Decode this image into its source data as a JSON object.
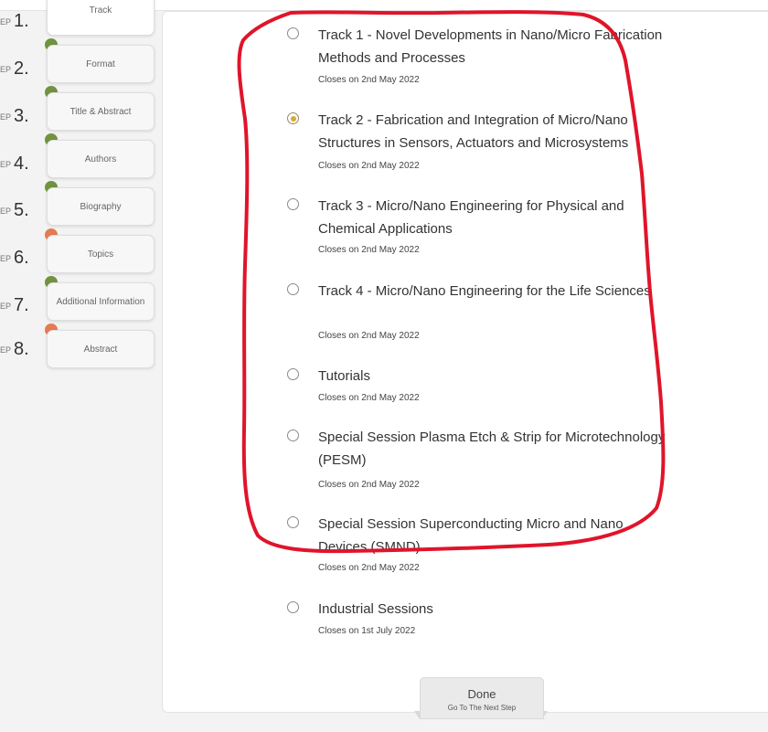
{
  "steps": [
    {
      "num": "1.",
      "label": "Track",
      "status": "active",
      "status_color": "none"
    },
    {
      "num": "2.",
      "label": "Format",
      "status": "complete",
      "status_color": "#72923f"
    },
    {
      "num": "3.",
      "label": "Title & Abstract",
      "status": "complete",
      "status_color": "#72923f"
    },
    {
      "num": "4.",
      "label": "Authors",
      "status": "complete",
      "status_color": "#72923f"
    },
    {
      "num": "5.",
      "label": "Biography",
      "status": "complete",
      "status_color": "#72923f"
    },
    {
      "num": "6.",
      "label": "Topics",
      "status": "incomplete",
      "status_color": "#e47b51"
    },
    {
      "num": "7.",
      "label": "Additional Information",
      "status": "complete",
      "status_color": "#72923f"
    },
    {
      "num": "8.",
      "label": "Abstract",
      "status": "incomplete",
      "status_color": "#e47b51"
    }
  ],
  "step_prefix": "EP",
  "tracks": [
    {
      "title": "Track 1 - Novel Developments in Nano/Micro Fabrication Methods and Processes",
      "closes": "Closes on 2nd May 2022",
      "selected": false
    },
    {
      "title": "Track 2 - Fabrication and Integration of Micro/Nano Structures in Sensors, Actuators and Microsystems",
      "closes": "Closes on 2nd May 2022",
      "selected": true
    },
    {
      "title": "Track 3 - Micro/Nano Engineering for Physical and Chemical Applications",
      "closes": "Closes on 2nd May 2022",
      "selected": false
    },
    {
      "title": "Track 4 - Micro/Nano Engineering for the Life Sciences",
      "closes": "Closes on 2nd May 2022",
      "selected": false
    },
    {
      "title": "Tutorials",
      "closes": "Closes on 2nd May 2022",
      "selected": false
    },
    {
      "title": "Special Session Plasma Etch & Strip for Microtechnology (PESM)",
      "closes": "Closes on 2nd May 2022",
      "selected": false
    },
    {
      "title": "Special Session Superconducting Micro and Nano Devices (SMND)",
      "closes": "Closes on 2nd May 2022",
      "selected": false
    },
    {
      "title": "Industrial Sessions",
      "closes": "Closes on 1st July 2022",
      "selected": false
    }
  ],
  "done": {
    "label": "Done",
    "sub": "Go To The Next Step"
  },
  "colors": {
    "accent": "#d4a93b",
    "complete": "#72923f",
    "incomplete": "#e47b51",
    "annotation": "#e0142a"
  }
}
